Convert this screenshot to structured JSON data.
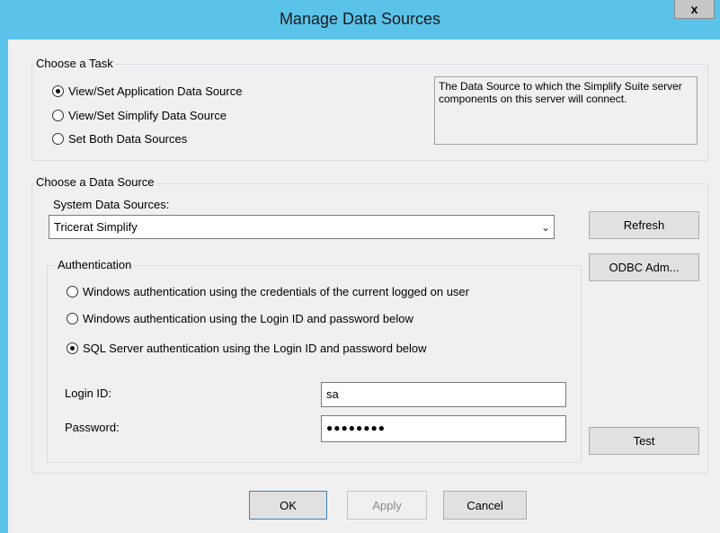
{
  "window": {
    "title": "Manage Data Sources",
    "close_glyph": "x"
  },
  "task_group": {
    "legend": "Choose a Task",
    "options": [
      {
        "label": "View/Set Application Data Source",
        "checked": true
      },
      {
        "label": "View/Set Simplify Data Source",
        "checked": false
      },
      {
        "label": "Set Both Data Sources",
        "checked": false
      }
    ],
    "description": "The Data Source to which the Simplify Suite server components on this server will connect."
  },
  "source_group": {
    "legend": "Choose a Data Source",
    "system_label": "System Data Sources:",
    "selected_source": "Tricerat Simplify",
    "refresh_label": "Refresh",
    "odbc_label": "ODBC Adm...",
    "test_label": "Test"
  },
  "auth_group": {
    "legend": "Authentication",
    "options": [
      {
        "label": "Windows authentication using the credentials of the current logged on user",
        "checked": false
      },
      {
        "label": "Windows authentication using the Login ID and password below",
        "checked": false
      },
      {
        "label": "SQL Server authentication using the Login ID and password below",
        "checked": true
      }
    ],
    "login_label": "Login ID:",
    "login_value": "sa",
    "password_label": "Password:",
    "password_value": "●●●●●●●●"
  },
  "footer": {
    "ok_label": "OK",
    "apply_label": "Apply",
    "cancel_label": "Cancel"
  }
}
